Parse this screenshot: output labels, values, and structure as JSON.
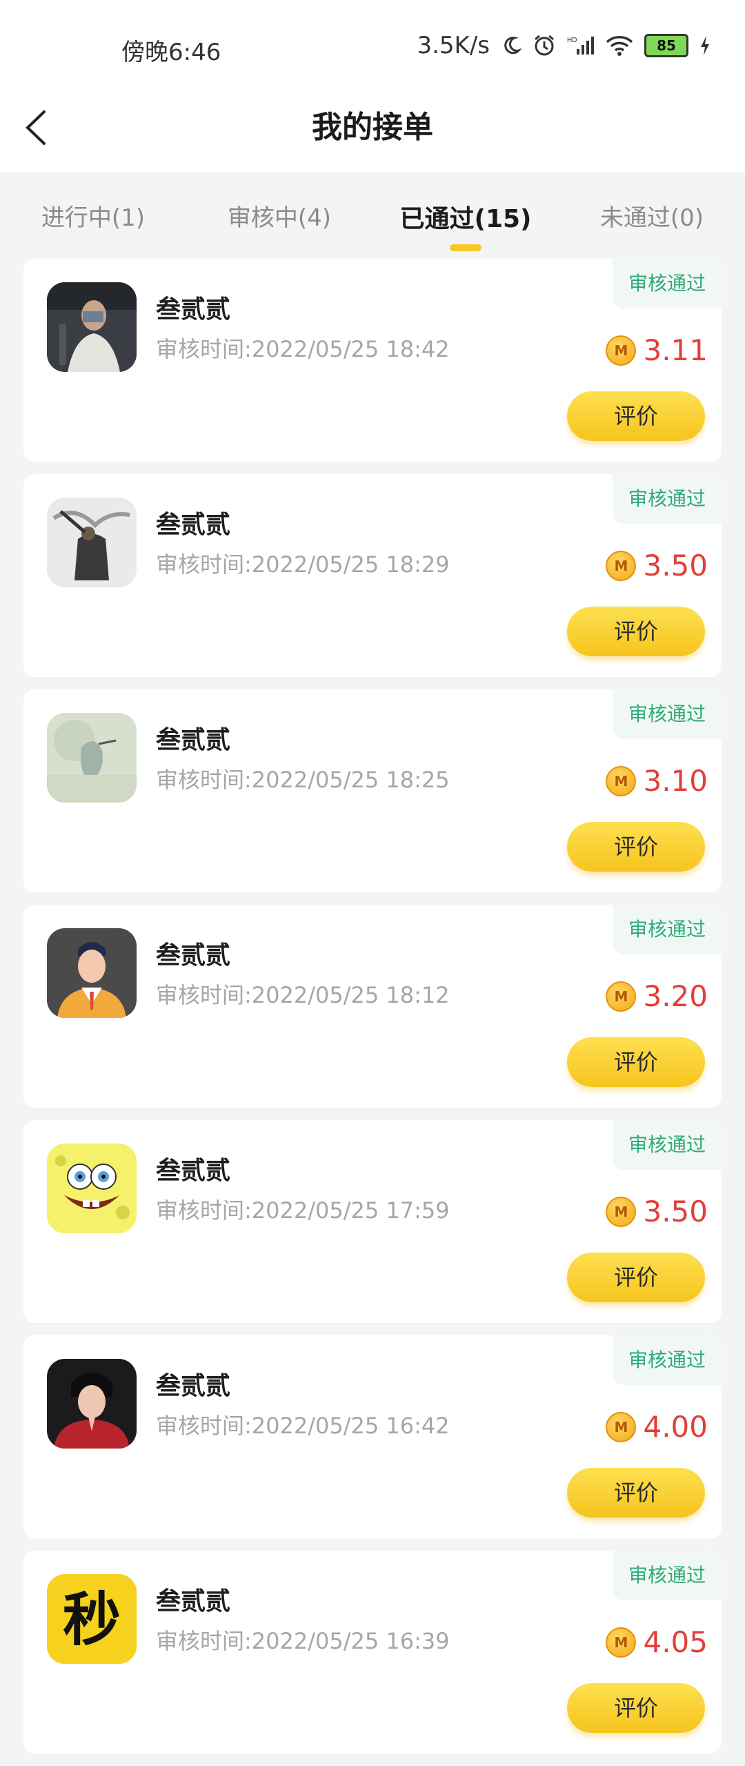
{
  "status_bar": {
    "time": "傍晚6:46",
    "network_speed": "3.5K/s",
    "battery": "85",
    "icons": [
      "moon-icon",
      "alarm-icon",
      "signal-icon",
      "wifi-icon",
      "battery-icon",
      "charging-icon"
    ]
  },
  "header": {
    "title": "我的接单"
  },
  "tabs": [
    {
      "label": "进行中(1)",
      "active": false
    },
    {
      "label": "审核中(4)",
      "active": false
    },
    {
      "label": "已通过(15)",
      "active": true
    },
    {
      "label": "未通过(0)",
      "active": false
    }
  ],
  "orders": [
    {
      "name": "叁贰贰",
      "time": "审核时间:2022/05/25 18:42",
      "status": "审核通过",
      "amount": "3.11",
      "action": "评价",
      "avatar": "photo-gym"
    },
    {
      "name": "叁贰贰",
      "time": "审核时间:2022/05/25 18:29",
      "status": "审核通过",
      "amount": "3.50",
      "action": "评价",
      "avatar": "photo-wind"
    },
    {
      "name": "叁贰贰",
      "time": "审核时间:2022/05/25 18:25",
      "status": "审核通过",
      "amount": "3.10",
      "action": "评价",
      "avatar": "photo-watercolor"
    },
    {
      "name": "叁贰贰",
      "time": "审核时间:2022/05/25 18:12",
      "status": "审核通过",
      "amount": "3.20",
      "action": "评价",
      "avatar": "cartoon-businessman"
    },
    {
      "name": "叁贰贰",
      "time": "审核时间:2022/05/25 17:59",
      "status": "审核通过",
      "amount": "3.50",
      "action": "评价",
      "avatar": "spongebob"
    },
    {
      "name": "叁贰贰",
      "time": "审核时间:2022/05/25 16:42",
      "status": "审核通过",
      "amount": "4.00",
      "action": "评价",
      "avatar": "photo-red"
    },
    {
      "name": "叁贰贰",
      "time": "审核时间:2022/05/25 16:39",
      "status": "审核通过",
      "amount": "4.05",
      "action": "评价",
      "avatar": "logo-miao",
      "avatar_text": "秒"
    }
  ],
  "colors": {
    "accent": "#f7c928",
    "price": "#e33f3a",
    "status": "#2eaa78"
  }
}
